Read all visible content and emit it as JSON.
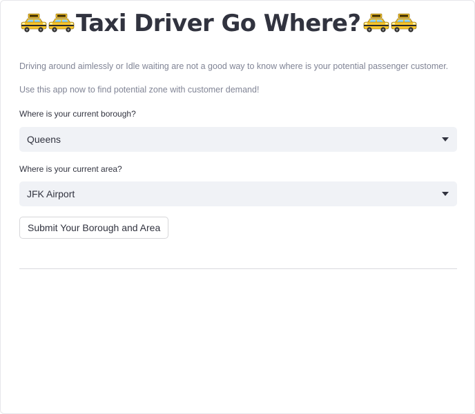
{
  "header": {
    "title": "Taxi Driver Go Where?",
    "leading_icons": [
      "taxi-icon",
      "taxi-icon"
    ],
    "trailing_icons": [
      "taxi-icon",
      "taxi-icon"
    ]
  },
  "intro": {
    "line1": "Driving around aimlessly or Idle waiting are not a good way to know where is your potential passenger customer.",
    "line2": "Use this app now to find potential zone with customer demand!"
  },
  "borough": {
    "label": "Where is your current borough?",
    "value": "Queens"
  },
  "area": {
    "label": "Where is your current area?",
    "value": "JFK Airport"
  },
  "submit": {
    "label": "Submit Your Borough and Area"
  },
  "colors": {
    "select_bg": "#f0f2f6",
    "text": "#31333f",
    "muted_text": "#808495",
    "taxi_yellow": "#f7c52b"
  }
}
